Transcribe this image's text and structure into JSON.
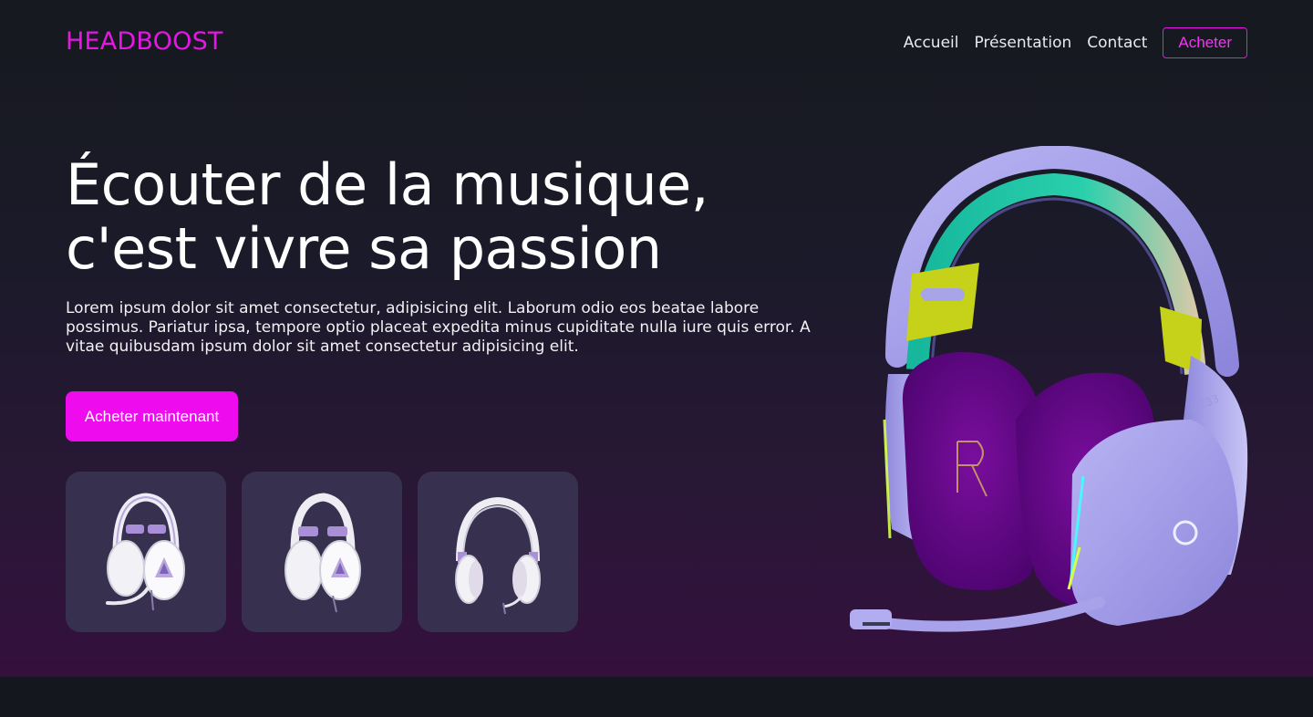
{
  "brand": {
    "logo": "HEADBOOST"
  },
  "nav": {
    "items": [
      "Accueil",
      "Présentation",
      "Contact"
    ],
    "buy_label": "Acheter"
  },
  "hero": {
    "headline_line1": "Écouter de la musique,",
    "headline_line2": "c'est vivre sa passion",
    "paragraph": "Lorem ipsum dolor sit amet consectetur, adipisicing elit. Laborum odio eos beatae labore possimus. Pariatur ipsa, tempore optio placeat expedita minus cupiditate nulla iure quis error. A vitae quibusdam ipsum dolor sit amet consectetur adipisicing elit.",
    "cta_label": "Acheter maintenant",
    "thumbnails": [
      {
        "icon": "white-headset-front-icon"
      },
      {
        "icon": "white-headset-side-icon"
      },
      {
        "icon": "white-headset-back-icon"
      }
    ],
    "product_image": "lilac-gaming-headset-image"
  },
  "colors": {
    "accent": "#e616e6",
    "cta": "#ee0cee",
    "background": "#16191f",
    "thumb_bg": "#38304f"
  }
}
